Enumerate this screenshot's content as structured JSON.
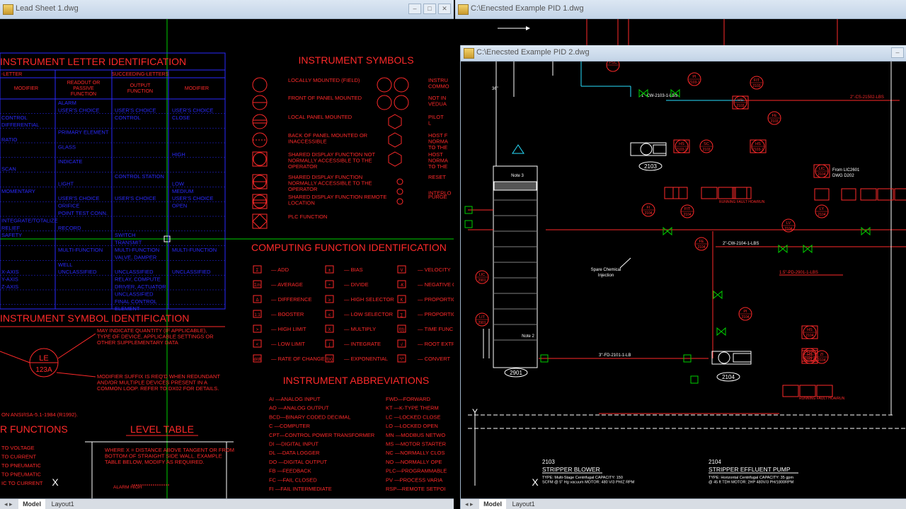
{
  "windows": {
    "left_title": "Lead Sheet 1.dwg",
    "right_back_title": "C:\\Enecsted Example PID 1.dwg",
    "right_front_title": "C:\\Enecsted Example PID 2.dwg"
  },
  "tabs": {
    "model": "Model",
    "layout": "Layout1"
  },
  "legend": {
    "letter_id_title": "INSTRUMENT LETTER IDENTIFICATION",
    "first_letter_hdr": "-LETTER",
    "succeeding_hdr": "SUCCEEDING-LETTERS",
    "col_modifier": "MODIFIER",
    "col_readout": "READOUT OR PASSIVE FUNCTION",
    "col_output": "OUTPUT FUNCTION",
    "col_modifier2": "MODIFIER",
    "rows": [
      [
        "",
        "ALARM",
        "",
        ""
      ],
      [
        "",
        "USER'S CHOICE",
        "USER'S CHOICE",
        "USER'S CHOICE"
      ],
      [
        "CONTROL",
        "",
        "CONTROL",
        "CLOSE"
      ],
      [
        "DIFFERENTIAL",
        "",
        "",
        ""
      ],
      [
        "",
        "PRIMARY ELEMENT",
        "",
        ""
      ],
      [
        "RATIO",
        "",
        "",
        ""
      ],
      [
        "",
        "GLASS",
        "",
        ""
      ],
      [
        "",
        "",
        "",
        "HIGH"
      ],
      [
        "",
        "INDICATE",
        "",
        ""
      ],
      [
        "SCAN",
        "",
        "",
        ""
      ],
      [
        "",
        "",
        "CONTROL STATION",
        ""
      ],
      [
        "",
        "LIGHT",
        "",
        "LOW"
      ],
      [
        "MOMENTARY",
        "",
        "",
        "MEDIUM"
      ],
      [
        "",
        "USER'S CHOICE",
        "USER'S CHOICE",
        "USER'S CHOICE"
      ],
      [
        "",
        "ORIFICE",
        "",
        "OPEN"
      ],
      [
        "",
        "POINT TEST CONN.",
        "",
        ""
      ],
      [
        "INTEGRATE/TOTALIZE",
        "",
        "",
        ""
      ],
      [
        "RELIEF",
        "RECORD",
        "",
        ""
      ],
      [
        "SAFETY",
        "",
        "SWITCH",
        ""
      ],
      [
        "",
        "",
        "TRANSMIT",
        ""
      ],
      [
        "",
        "MULTI-FUNCTION",
        "MULTI-FUNCTION",
        "MULTI-FUNCTION"
      ],
      [
        "",
        "",
        "VALVE, DAMPER",
        ""
      ],
      [
        "",
        "WELL",
        "",
        ""
      ],
      [
        "X-AXIS",
        "UNCLASSIFIED",
        "UNCLASSIFIED",
        "UNCLASSIFIED"
      ],
      [
        "Y-AXIS",
        "",
        "RELAY, COMPUTE",
        ""
      ],
      [
        "Z-AXIS",
        "",
        "DRIVER, ACTUATOR",
        ""
      ],
      [
        "",
        "",
        "UNCLASSIFIED",
        ""
      ],
      [
        "",
        "",
        "FINAL CONTROL",
        ""
      ],
      [
        "",
        "",
        "ELEMENT",
        ""
      ]
    ],
    "symbols_title": "INSTRUMENT SYMBOLS",
    "symbols": [
      "LOCALLY MOUNTED (FIELD)",
      "FRONT OF PANEL MOUNTED",
      "LOCAL PANEL MOUNTED",
      "BACK OF PANEL MOUNTED OR INACCESSIBLE",
      "SHARED DISPLAY FUNCTION NOT NORMALLY ACCESSIBLE TO THE OPERATOR",
      "SHARED DISPLAY FUNCTION NORMALLY ACCESSIBLE TO THE OPERATOR",
      "SHARED DISPLAY FUNCTION REMOTE LOCATION",
      "PLC FUNCTION"
    ],
    "symbols_right": [
      "INSTRU COMMO",
      "NOT IN VEDUA",
      "PILOT L",
      "HOST F NORMA TO THE",
      "HOST NORMA TO THE",
      "RESET",
      "INTERLO",
      "PURGE"
    ],
    "computing_title": "COMPUTING FUNCTION IDENTIFICATION",
    "computing": [
      [
        "ADD",
        "BIAS",
        "VELOCITY"
      ],
      [
        "AVERAGE",
        "DIVIDE",
        "NEGATIVE C"
      ],
      [
        "DIFFERENCE",
        "HIGH SELECTOR",
        "PROPORTIO"
      ],
      [
        "BOOSTER",
        "LOW SELECTOR",
        "PROPORTIO"
      ],
      [
        "HIGH LIMIT",
        "MULTIPLY",
        "TIME FUNC"
      ],
      [
        "LOW LIMIT",
        "INTEGRATE",
        "ROOT EXTR"
      ],
      [
        "RATE OF CHANGE",
        "EXPONENTIAL",
        "CONVERT"
      ]
    ],
    "abbrev_title": "INSTRUMENT ABBREVIATIONS",
    "abbrev_left": [
      "AI  —ANALOG INPUT",
      "AO  —ANALOG OUTPUT",
      "BCD—BINARY CODED DECIMAL",
      "C   —COMPUTER",
      "CPT—CONTROL POWER TRANSFORMER",
      "DI  —DIGITAL INPUT",
      "DL  —DATA LOGGER",
      "DO  —DIGITAL OUTPUT",
      "FB  —FEEDBACK",
      "FC  —FAIL CLOSED",
      "FI  —FAIL INTERMEDIATE"
    ],
    "abbrev_right": [
      "FWD—FORWARD",
      "KT  —K-TYPE THERM",
      "LC  —LOCKED CLOSE",
      "LO  —LOCKED OPEN",
      "MN —MODBUS NETWO",
      "MS —MOTOR STARTER",
      "NC  —NORMALLY CLOS",
      "NO  —NORMALLY OPE",
      "PLC—PROGRAMMABLE",
      "PV  —PROCESS VARIA",
      "RSP—REMOTE SETPOI"
    ],
    "symbol_id_title": "INSTRUMENT SYMBOL IDENTIFICATION",
    "symbol_id_note1": "MAY INDICATE QUANTITY (IF APPLICABLE), TYPE OF DEVICE, APPLICABLE SETTINGS OR OTHER SUPPLEMENTARY DATA",
    "symbol_id_note2": "MODIFIER SUFFIX IS REQ'D WHEN REDUNDANT AND/OR MULTIPLE DEVICES PRESENT IN A COMMON LOOP. REFER TO DX02 FOR DETAILS.",
    "bubble_top": "LE",
    "bubble_bottom": "123A",
    "ansi_note": "ON ANSI/ISA-5.1-1984 (R1992).",
    "relay_title": "R FUNCTIONS",
    "relay_items": [
      "TO VOLTAGE",
      "TO CURRENT",
      "TO PNEUMATIC",
      "TO PNEUMATIC",
      "IC TO CURRENT"
    ],
    "level_title": "LEVEL TABLE",
    "level_note": "WHERE X = DISTANCE ABOVE TANGENT OR FROM BOTTOM OF STRAIGHT SIDE WALL. EXAMPLE TABLE BELOW, MODIFY AS REQUIRED.",
    "level_alarm": "ALARM HIGH"
  },
  "pid": {
    "tags": [
      {
        "t": "PSC",
        "n": ""
      },
      {
        "t": "PI",
        "n": "2103-1"
      },
      {
        "t": "FIT",
        "n": "2103"
      },
      {
        "t": "HS",
        "n": "2103"
      },
      {
        "t": "FE",
        "n": "2103"
      },
      {
        "t": "HS",
        "n": "2103-2"
      },
      {
        "t": "SC",
        "n": "2103"
      },
      {
        "t": "HS",
        "n": "2103-1"
      },
      {
        "t": "LIC",
        "n": "2104"
      },
      {
        "t": "LY",
        "n": "2104"
      },
      {
        "t": "LV",
        "n": "2104"
      },
      {
        "t": "FI",
        "n": "2104"
      },
      {
        "t": "FIT",
        "n": "2104"
      },
      {
        "t": "LIC",
        "n": "2901"
      },
      {
        "t": "LIT",
        "n": "2901"
      },
      {
        "t": "FE",
        "n": "2104"
      },
      {
        "t": "PI",
        "n": "2104"
      },
      {
        "t": "HS",
        "n": "2104"
      },
      {
        "t": "HS",
        "n": "2104-2"
      },
      {
        "t": "HS",
        "n": "2104-1"
      },
      {
        "t": "ZI",
        "n": "2104"
      }
    ],
    "from_note": "From LIC2601 DWG D202",
    "spare_note": "Spare Chemical Injection",
    "note3": "Note 3",
    "note2": "Note 2",
    "blower_tag": "2103",
    "tower_tag": "2901",
    "pump_tag": "2104",
    "status_labels": [
      "RUNNING",
      "FAULT",
      "HOA/RUN"
    ],
    "blower_no": "2103",
    "blower_name": "STRIPPER BLOWER",
    "blower_spec": "TYPE: Multi-Stage Centrifugal CAPACITY: 150 SCFM @ 5\" Hg vacuum MOTOR: 480 V/3 PH/Z RPM",
    "pump_no": "2104",
    "pump_name": "STRIPPER EFFLUENT PUMP",
    "pump_spec": "TYPE: Horizontal Centrifugal CAPACITY: 35 gpm @ 45 ft TDH MOTOR: 2HP 480V/3 PH/1800RPM",
    "line_labels": [
      "1\"-CW-2103-1-LBS",
      "2\"-CS-21502-LBS",
      "2\"-CW-2104-1-LBS",
      "1.5\"-PD-2901-1-LBS",
      "3\"-FD-2101-1-LB"
    ]
  },
  "colors": {
    "cad_bg": "#000000",
    "red": "#ff2a2a",
    "blue": "#2a2aff",
    "green": "#00d000",
    "cyan": "#28e0ff",
    "yellow": "#ffff30"
  }
}
